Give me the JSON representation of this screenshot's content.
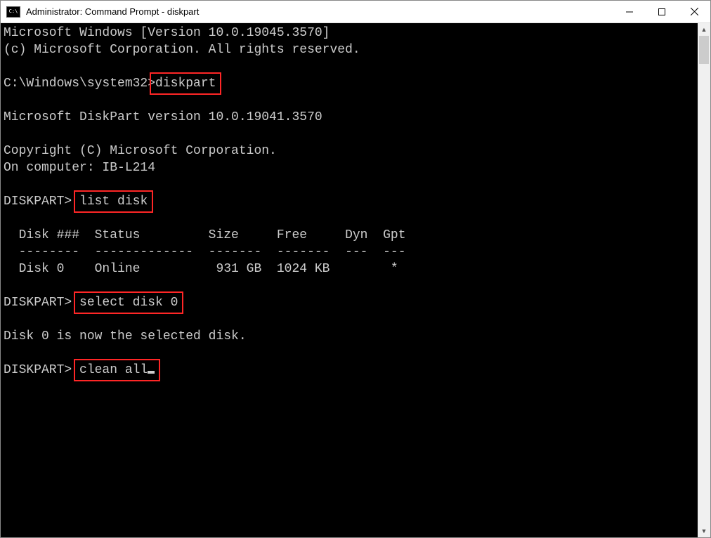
{
  "window": {
    "icon_label": "C:\\",
    "title": "Administrator: Command Prompt - diskpart"
  },
  "terminal": {
    "line_winver": "Microsoft Windows [Version 10.0.19045.3570]",
    "line_copyright1": "(c) Microsoft Corporation. All rights reserved.",
    "prompt1_prefix": "C:\\Windows\\system32>",
    "cmd1": "diskpart",
    "line_dpver": "Microsoft DiskPart version 10.0.19041.3570",
    "line_dpcopyright": "Copyright (C) Microsoft Corporation.",
    "line_computer": "On computer: IB-L214",
    "prompt2_prefix": "DISKPART> ",
    "cmd2": "list disk",
    "table_header": "  Disk ###  Status         Size     Free     Dyn  Gpt",
    "table_divider": "  --------  -------------  -------  -------  ---  ---",
    "table_row0": "  Disk 0    Online          931 GB  1024 KB        *",
    "prompt3_prefix": "DISKPART> ",
    "cmd3": "select disk 0",
    "line_selected": "Disk 0 is now the selected disk.",
    "prompt4_prefix": "DISKPART> ",
    "cmd4": "clean all"
  },
  "controls": {
    "minimize_tip": "Minimize",
    "maximize_tip": "Maximize",
    "close_tip": "Close"
  },
  "highlight_color": "#ff2626"
}
